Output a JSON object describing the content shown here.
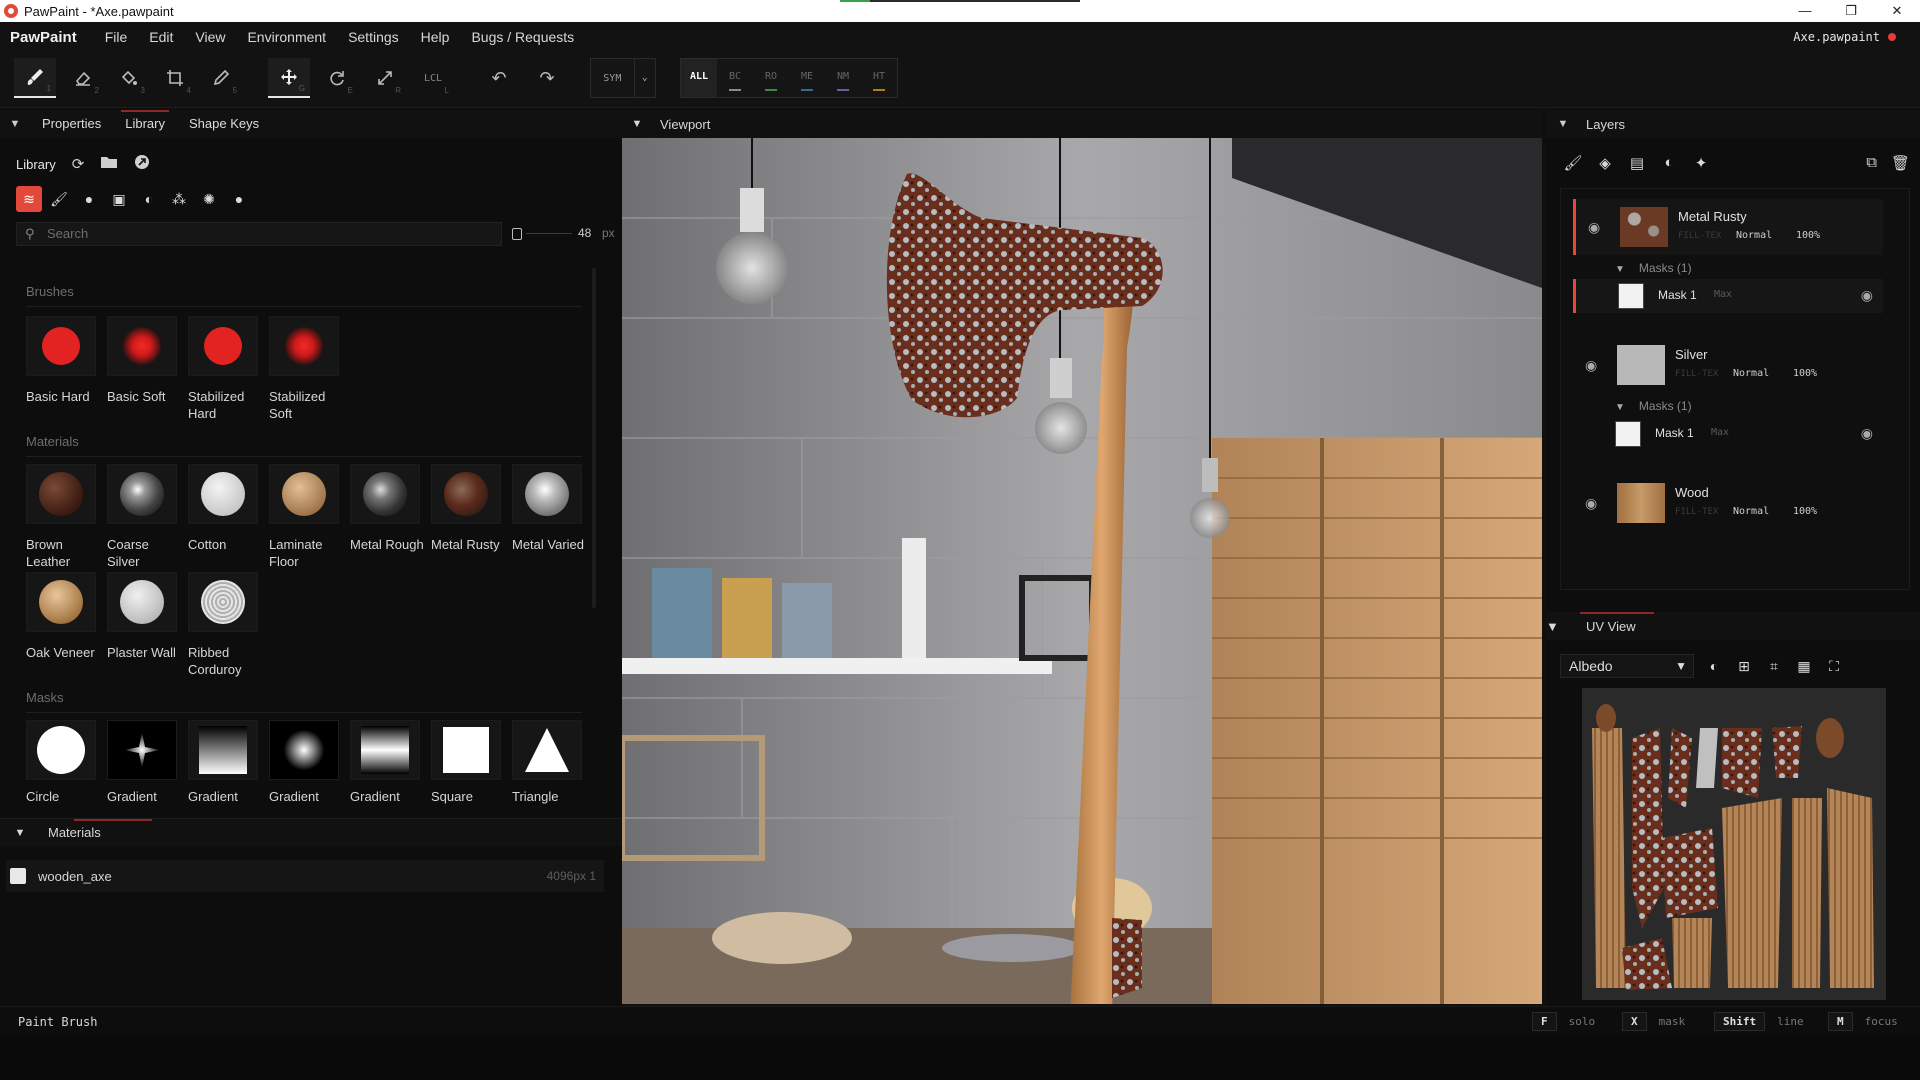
{
  "window": {
    "title": "PawPaint - *Axe.pawpaint",
    "controls": [
      "—",
      "❐",
      "✕"
    ]
  },
  "menubar": {
    "brand": "PawPaint",
    "items": [
      "File",
      "Edit",
      "View",
      "Environment",
      "Settings",
      "Help",
      "Bugs / Requests"
    ],
    "file_name": "Axe.pawpaint"
  },
  "toolbar": {
    "tools": [
      {
        "name": "paint-brush-tool",
        "glyph": "🖌",
        "key": "1"
      },
      {
        "name": "eraser-tool",
        "glyph": "⌫",
        "key": "2"
      },
      {
        "name": "fill-tool",
        "glyph": "◈",
        "key": "3"
      },
      {
        "name": "crop-tool",
        "glyph": "⌗",
        "key": "4"
      },
      {
        "name": "picker-tool",
        "glyph": "✎",
        "key": "5"
      },
      {
        "name": "move-tool",
        "glyph": "✥",
        "key": "G"
      },
      {
        "name": "rotate-tool",
        "glyph": "⟳",
        "key": "E"
      },
      {
        "name": "scale-tool",
        "glyph": "⤢",
        "key": "R"
      },
      {
        "name": "local-tool",
        "glyph": "LCL",
        "key": "L"
      }
    ],
    "undo": "↶",
    "redo": "↷",
    "sym": "SYM",
    "channels": [
      {
        "label": "ALL",
        "color": ""
      },
      {
        "label": "BC",
        "color": "#8a8a8a"
      },
      {
        "label": "RO",
        "color": "#3a8a4a"
      },
      {
        "label": "ME",
        "color": "#3a6a8a"
      },
      {
        "label": "NM",
        "color": "#6a5aa8"
      },
      {
        "label": "HT",
        "color": "#b07a2a"
      }
    ]
  },
  "left_panel": {
    "tabs": [
      "Properties",
      "Library",
      "Shape Keys"
    ],
    "library_title": "Library",
    "search_placeholder": "Search",
    "size_value": "48",
    "size_unit": "px",
    "sections": {
      "brushes": "Brushes",
      "materials": "Materials",
      "masks": "Masks"
    },
    "brushes": [
      "Basic Hard",
      "Basic Soft",
      "Stabilized Hard",
      "Stabilized Soft"
    ],
    "materials": [
      "Brown Leather",
      "Coarse Silver",
      "Cotton",
      "Laminate Floor",
      "Metal Rough",
      "Metal Rusty",
      "Metal Varied",
      "Oak Veneer",
      "Plaster Wall",
      "Ribbed Corduroy"
    ],
    "masks": [
      "Circle",
      "Gradient",
      "Gradient",
      "Gradient",
      "Gradient",
      "Square",
      "Triangle"
    ]
  },
  "materials_panel": {
    "title": "Materials",
    "items": [
      {
        "name": "wooden_axe",
        "res": "4096px 1"
      }
    ]
  },
  "viewport": {
    "title": "Viewport"
  },
  "layers": {
    "title": "Layers",
    "items": [
      {
        "name": "Metal Rusty",
        "type": "FILL-TEX",
        "blend": "Normal",
        "opacity": "100%",
        "masks_label": "Masks (1)",
        "mask": {
          "name": "Mask 1",
          "mode": "Max"
        }
      },
      {
        "name": "Silver",
        "type": "FILL-TEX",
        "blend": "Normal",
        "opacity": "100%",
        "masks_label": "Masks (1)",
        "mask": {
          "name": "Mask 1",
          "mode": "Max"
        }
      },
      {
        "name": "Wood",
        "type": "FILL-TEX",
        "blend": "Normal",
        "opacity": "100%"
      }
    ]
  },
  "uv_view": {
    "title": "UV View",
    "channel": "Albedo"
  },
  "status": {
    "text": "Paint Brush",
    "hotkeys": [
      {
        "key": "F",
        "label": "solo"
      },
      {
        "key": "X",
        "label": "mask"
      },
      {
        "key": "Shift",
        "label": "line"
      },
      {
        "key": "M",
        "label": "focus"
      }
    ]
  },
  "colors": {
    "accent": "#e2493b",
    "brush_red": "#e32222",
    "panel_bg": "#0d0d0d"
  }
}
